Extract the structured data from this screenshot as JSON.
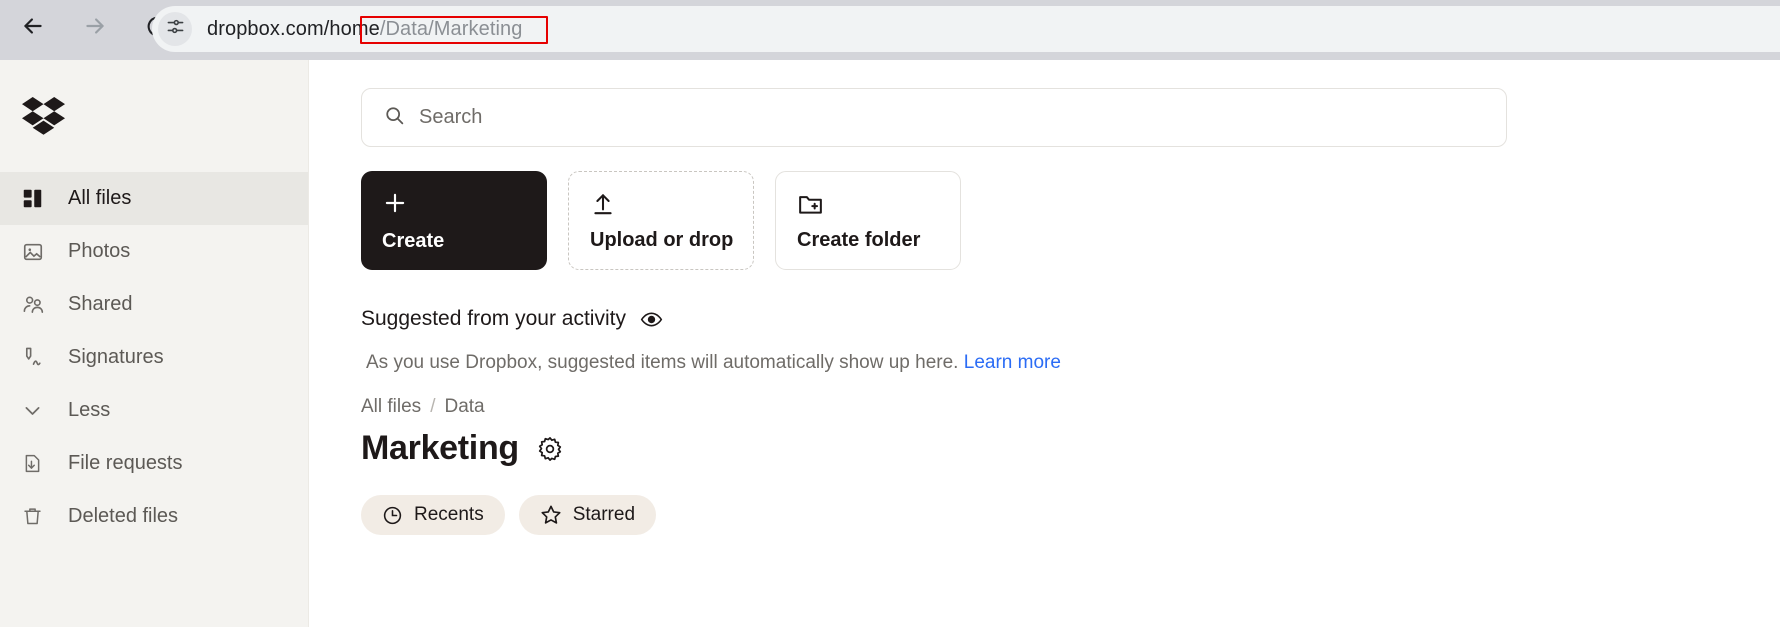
{
  "browser": {
    "back_icon": "arrow-left-icon",
    "forward_icon": "arrow-right-icon",
    "reload_icon": "reload-icon",
    "site_info_icon": "page-settings-icon",
    "url_host": "dropbox.com/home",
    "url_path": "/Data/Marketing",
    "highlight_color": "#e60000"
  },
  "sidebar": {
    "logo": "dropbox-logo",
    "items": [
      {
        "label": "All files",
        "icon": "all-files-icon",
        "active": true
      },
      {
        "label": "Photos",
        "icon": "photos-icon",
        "active": false
      },
      {
        "label": "Shared",
        "icon": "shared-people-icon",
        "active": false
      },
      {
        "label": "Signatures",
        "icon": "signature-pen-icon",
        "active": false
      },
      {
        "label": "Less",
        "icon": "chevron-down-icon",
        "active": false
      },
      {
        "label": "File requests",
        "icon": "file-request-icon",
        "active": false
      },
      {
        "label": "Deleted files",
        "icon": "trash-icon",
        "active": false
      }
    ]
  },
  "search": {
    "placeholder": "Search",
    "value": "",
    "icon": "search-icon"
  },
  "actions": [
    {
      "label": "Create",
      "icon": "plus-icon",
      "style": "primary"
    },
    {
      "label": "Upload or drop",
      "icon": "upload-arrow-icon",
      "style": "dashed"
    },
    {
      "label": "Create folder",
      "icon": "folder-plus-icon",
      "style": "solid"
    }
  ],
  "suggested": {
    "title": "Suggested from your activity",
    "eye_icon": "eye-icon",
    "empty_text": "As you use Dropbox, suggested items will automatically show up here.",
    "learn_more": "Learn more",
    "link_color": "#2b6cf5"
  },
  "breadcrumb": {
    "items": [
      "All files",
      "Data"
    ],
    "separator": "/"
  },
  "page": {
    "title": "Marketing",
    "settings_icon": "gear-icon"
  },
  "chips": [
    {
      "label": "Recents",
      "icon": "clock-icon"
    },
    {
      "label": "Starred",
      "icon": "star-icon"
    }
  ]
}
